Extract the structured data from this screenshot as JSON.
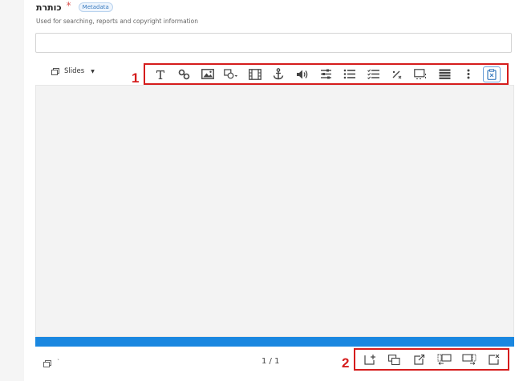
{
  "field": {
    "title": "כותרת",
    "required_marker": "*",
    "badge": "Metadata",
    "help": "Used for searching, reports and copyright information",
    "value": ""
  },
  "slides_menu": {
    "label": "Slides"
  },
  "callouts": {
    "one": "1",
    "two": "2"
  },
  "toolbar": {
    "icons": [
      "text-icon",
      "link-icon",
      "image-icon",
      "shape-icon",
      "video-icon",
      "anchor-icon",
      "audio-icon",
      "sliders-icon",
      "numbered-list-icon",
      "checklist-icon",
      "fraction-icon",
      "hotspot-icon",
      "list-icon",
      "more-icon",
      "paste-icon"
    ],
    "active": "paste-icon"
  },
  "pager": {
    "current": "1 / 1"
  },
  "slide_tools": {
    "icons": [
      "add-slide-icon",
      "duplicate-slide-icon",
      "export-slide-icon",
      "move-slide-left-icon",
      "move-slide-right-icon",
      "delete-slide-icon"
    ]
  },
  "colors": {
    "accent": "#1a87e0",
    "highlight": "#d51c1c",
    "canvas": "#f3f3f3"
  }
}
